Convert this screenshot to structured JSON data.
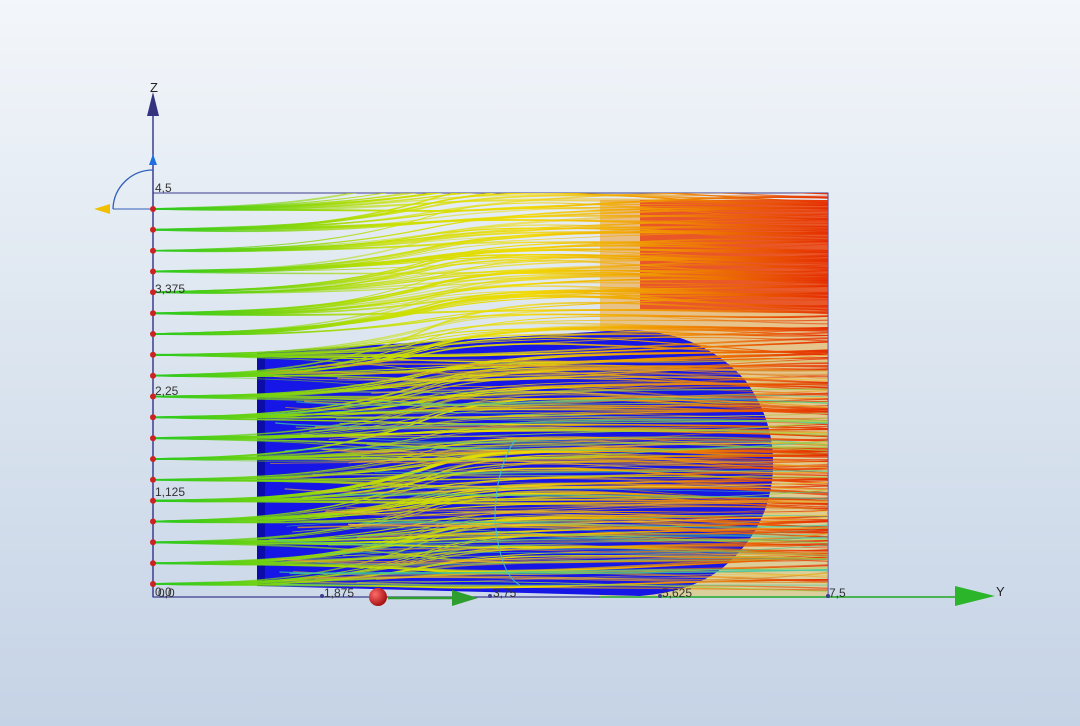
{
  "viewport": {
    "axes": {
      "z_label": "Z",
      "y_label": "Y",
      "z_ticks": [
        "4,5",
        "3,375",
        "2,25",
        "1,125",
        "0,0"
      ],
      "y_ticks": [
        "0,0",
        "1,875",
        "3,75",
        "5,625",
        "7,5"
      ]
    },
    "colors": {
      "body": "#1616e6",
      "axis": "#3d3d8f",
      "axis_z_arrow": "#33337f",
      "axis_y_arrow": "#2bb52b",
      "node": "#cc2222",
      "gizmo_sphere": "#c01818",
      "gizmo_arrow": "#2e9e2e",
      "rotation_handle": "#f0c000"
    },
    "streamlines": {
      "color_scale": [
        "#22cc22",
        "#b8e000",
        "#f0e000",
        "#f09000",
        "#e82000"
      ],
      "inlet_rows": 19
    }
  }
}
